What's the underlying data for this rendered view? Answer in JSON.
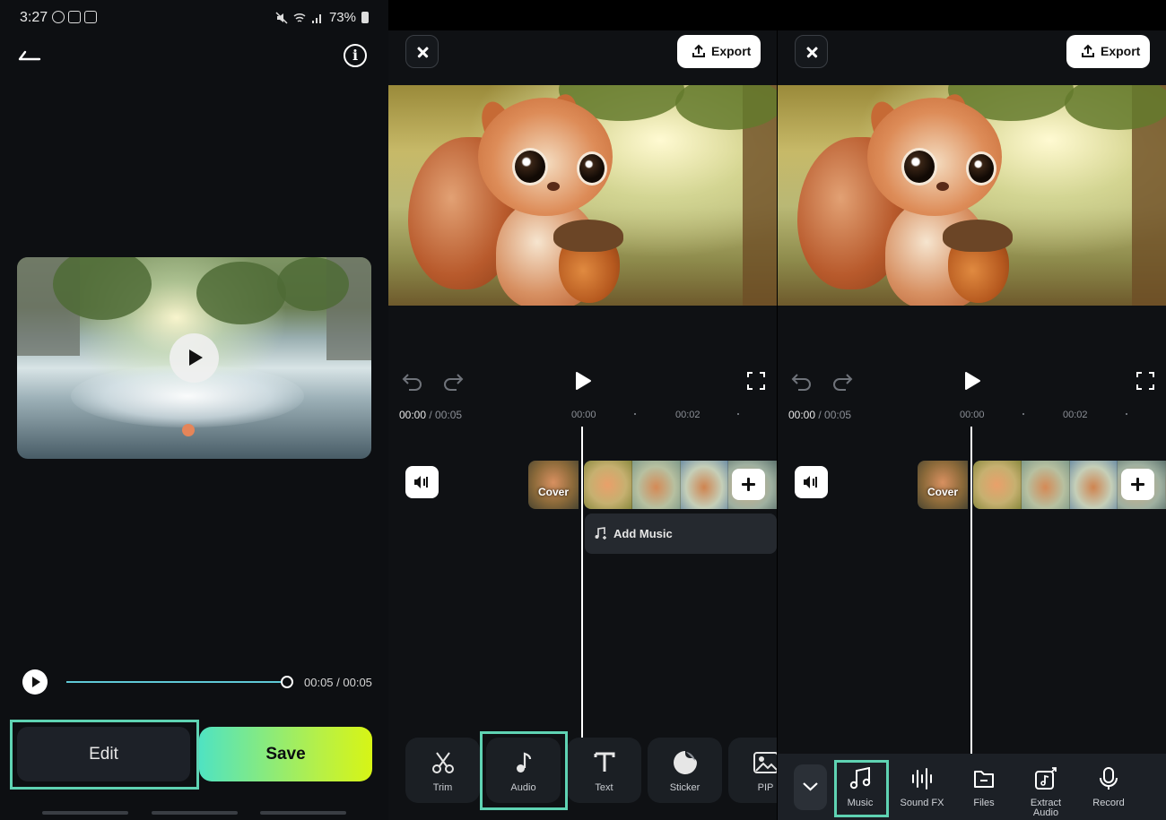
{
  "status_bar": {
    "time": "3:27",
    "battery": "73%"
  },
  "share_screen": {
    "info_label": "i",
    "playback_time": "00:05 / 00:05",
    "progress": 1.0,
    "edit_label": "Edit",
    "save_label": "Save"
  },
  "editor": {
    "export_label": "Export",
    "current_time": "00:00",
    "total_time": " / 00:05",
    "ruler": [
      "00:00",
      "00:02"
    ],
    "cover_label": "Cover",
    "add_music_label": "Add Music"
  },
  "toolbar": {
    "items": [
      {
        "label": "Trim",
        "icon": "scissors-icon"
      },
      {
        "label": "Audio",
        "icon": "music-note-icon"
      },
      {
        "label": "Text",
        "icon": "text-icon"
      },
      {
        "label": "Sticker",
        "icon": "sticker-icon"
      },
      {
        "label": "PIP",
        "icon": "image-icon"
      }
    ]
  },
  "audio_sheet": {
    "items": [
      {
        "label": "Music",
        "icon": "music-icon"
      },
      {
        "label": "Sound FX",
        "icon": "waveform-icon"
      },
      {
        "label": "Files",
        "icon": "folder-icon"
      },
      {
        "label": "Extract Audio",
        "icon": "extract-audio-icon"
      },
      {
        "label": "Record",
        "icon": "microphone-icon"
      }
    ]
  },
  "colors": {
    "highlight": "#5fd3b3",
    "save_gradient_start": "#4fe3c2",
    "save_gradient_end": "#d7f515",
    "progress": "#5fc9d6"
  }
}
